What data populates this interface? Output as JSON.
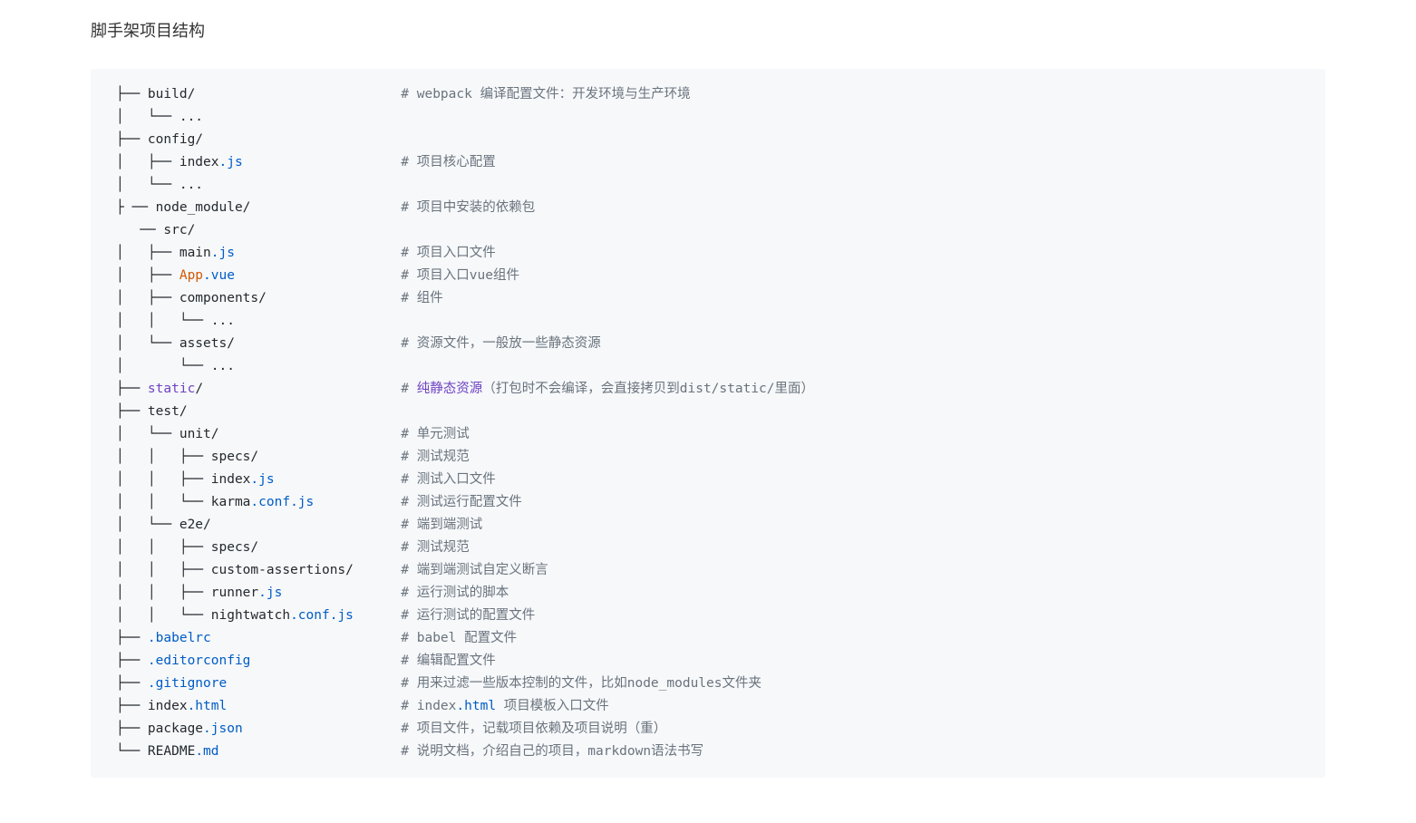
{
  "title": "脚手架项目结构",
  "lines": [
    {
      "segments": [
        {
          "text": "├── build/"
        },
        {
          "text": "                          # webpack 编译配置文件：开发环境与生产环境",
          "cls": "comment"
        }
      ]
    },
    {
      "segments": [
        {
          "text": "│   └── ..."
        }
      ]
    },
    {
      "segments": [
        {
          "text": "├── config/"
        }
      ]
    },
    {
      "segments": [
        {
          "text": "│   ├── index"
        },
        {
          "text": ".js",
          "cls": "blue"
        },
        {
          "text": "                    # 项目核心配置",
          "cls": "comment"
        }
      ]
    },
    {
      "segments": [
        {
          "text": "│   └── ..."
        }
      ]
    },
    {
      "segments": [
        {
          "text": "├ ── node_module/"
        },
        {
          "text": "                   # 项目中安装的依赖包",
          "cls": "comment"
        }
      ]
    },
    {
      "segments": [
        {
          "text": "   ── src/"
        }
      ]
    },
    {
      "segments": [
        {
          "text": "│   ├── main"
        },
        {
          "text": ".js",
          "cls": "blue"
        },
        {
          "text": "                     # 项目入口文件",
          "cls": "comment"
        }
      ]
    },
    {
      "segments": [
        {
          "text": "│   ├── "
        },
        {
          "text": "App",
          "cls": "orange"
        },
        {
          "text": ".vue",
          "cls": "blue"
        },
        {
          "text": "                     # 项目入口vue组件",
          "cls": "comment"
        }
      ]
    },
    {
      "segments": [
        {
          "text": "│   ├── components/"
        },
        {
          "text": "                 # 组件",
          "cls": "comment"
        }
      ]
    },
    {
      "segments": [
        {
          "text": "│   │   └── ..."
        }
      ]
    },
    {
      "segments": [
        {
          "text": "│   └── assets/"
        },
        {
          "text": "                     # 资源文件，一般放一些静态资源",
          "cls": "comment"
        }
      ]
    },
    {
      "segments": [
        {
          "text": "│       └── ..."
        }
      ]
    },
    {
      "segments": [
        {
          "text": "├── "
        },
        {
          "text": "static",
          "cls": "purple"
        },
        {
          "text": "/"
        },
        {
          "text": "                         # ",
          "cls": "comment"
        },
        {
          "text": "纯静态资源",
          "cls": "purple"
        },
        {
          "text": "（打包时不会编译，会直接拷贝到dist/static/里面）",
          "cls": "comment"
        }
      ]
    },
    {
      "segments": [
        {
          "text": "├── test/"
        }
      ]
    },
    {
      "segments": [
        {
          "text": "│   └── unit/"
        },
        {
          "text": "                       # 单元测试",
          "cls": "comment"
        }
      ]
    },
    {
      "segments": [
        {
          "text": "│   │   ├── specs/"
        },
        {
          "text": "                  # 测试规范",
          "cls": "comment"
        }
      ]
    },
    {
      "segments": [
        {
          "text": "│   │   ├── index"
        },
        {
          "text": ".js",
          "cls": "blue"
        },
        {
          "text": "                # 测试入口文件",
          "cls": "comment"
        }
      ]
    },
    {
      "segments": [
        {
          "text": "│   │   └── karma"
        },
        {
          "text": ".conf",
          "cls": "blue"
        },
        {
          "text": ".js",
          "cls": "blue"
        },
        {
          "text": "           # 测试运行配置文件",
          "cls": "comment"
        }
      ]
    },
    {
      "segments": [
        {
          "text": "│   └── e2e/"
        },
        {
          "text": "                        # 端到端测试",
          "cls": "comment"
        }
      ]
    },
    {
      "segments": [
        {
          "text": "│   │   ├── specs/"
        },
        {
          "text": "                  # 测试规范",
          "cls": "comment"
        }
      ]
    },
    {
      "segments": [
        {
          "text": "│   │   ├── custom-assertions/"
        },
        {
          "text": "      # 端到端测试自定义断言",
          "cls": "comment"
        }
      ]
    },
    {
      "segments": [
        {
          "text": "│   │   ├── runner"
        },
        {
          "text": ".js",
          "cls": "blue"
        },
        {
          "text": "               # 运行测试的脚本",
          "cls": "comment"
        }
      ]
    },
    {
      "segments": [
        {
          "text": "│   │   └── nightwatch"
        },
        {
          "text": ".conf",
          "cls": "blue"
        },
        {
          "text": ".js",
          "cls": "blue"
        },
        {
          "text": "      # 运行测试的配置文件",
          "cls": "comment"
        }
      ]
    },
    {
      "segments": [
        {
          "text": "├── "
        },
        {
          "text": ".babelrc",
          "cls": "blue"
        },
        {
          "text": "                        # babel 配置文件",
          "cls": "comment"
        }
      ]
    },
    {
      "segments": [
        {
          "text": "├── "
        },
        {
          "text": ".editorconfig",
          "cls": "blue"
        },
        {
          "text": "                   # 编辑配置文件",
          "cls": "comment"
        }
      ]
    },
    {
      "segments": [
        {
          "text": "├── "
        },
        {
          "text": ".gitignore",
          "cls": "blue"
        },
        {
          "text": "                      # 用来过滤一些版本控制的文件，比如node_modules文件夹",
          "cls": "comment"
        }
      ]
    },
    {
      "segments": [
        {
          "text": "├── index"
        },
        {
          "text": ".html",
          "cls": "blue"
        },
        {
          "text": "                      # index",
          "cls": "comment"
        },
        {
          "text": ".html",
          "cls": "blue"
        },
        {
          "text": " 项目模板入口文件",
          "cls": "comment"
        }
      ]
    },
    {
      "segments": [
        {
          "text": "├── package"
        },
        {
          "text": ".json",
          "cls": "blue"
        },
        {
          "text": "                    # 项目文件，记载项目依赖及项目说明（重）",
          "cls": "comment"
        }
      ]
    },
    {
      "segments": [
        {
          "text": "└── README"
        },
        {
          "text": ".md",
          "cls": "blue"
        },
        {
          "text": "                       # 说明文档，介绍自己的项目，markdown语法书写",
          "cls": "comment"
        }
      ]
    }
  ]
}
